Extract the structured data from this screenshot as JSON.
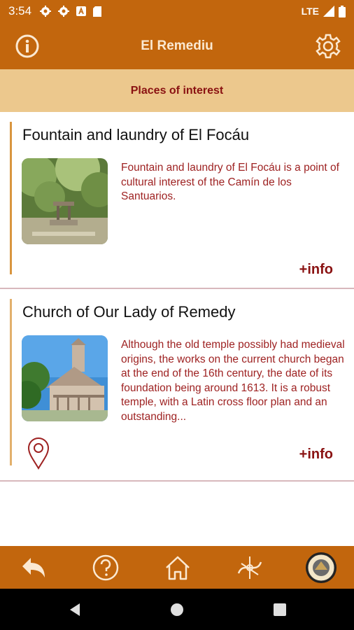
{
  "status_bar": {
    "time": "3:54",
    "network": "LTE",
    "icons": [
      "gear-icon",
      "gear-icon",
      "a-box-icon",
      "sd-card-icon",
      "signal-icon",
      "battery-icon"
    ]
  },
  "app_bar": {
    "title": "El Remediu",
    "left_icon": "info-icon",
    "right_icon": "settings-icon"
  },
  "section": {
    "title": "Places of interest"
  },
  "places": [
    {
      "title": "Fountain and laundry of El Focáu",
      "description": "Fountain and laundry of El Focáu is a point of cultural interest of the Camín de los Santuarios.",
      "more_label": "+info",
      "has_location_pin": false
    },
    {
      "title": "Church of Our Lady of Remedy",
      "description": "Although the old temple possibly had medieval origins, the works on the current church began at the end of the 16th century, the date of its foundation being around 1613. It is a robust temple, with a Latin cross floor plan and an outstanding...",
      "more_label": "+info",
      "has_location_pin": true
    }
  ],
  "bottom_nav": [
    "back-icon",
    "help-icon",
    "home-icon",
    "route-icon",
    "camino-logo"
  ],
  "colors": {
    "primary": "#c2660d",
    "section_bg": "#ecc88d",
    "accent_text": "#8a1212",
    "description_text": "#9e2222"
  }
}
